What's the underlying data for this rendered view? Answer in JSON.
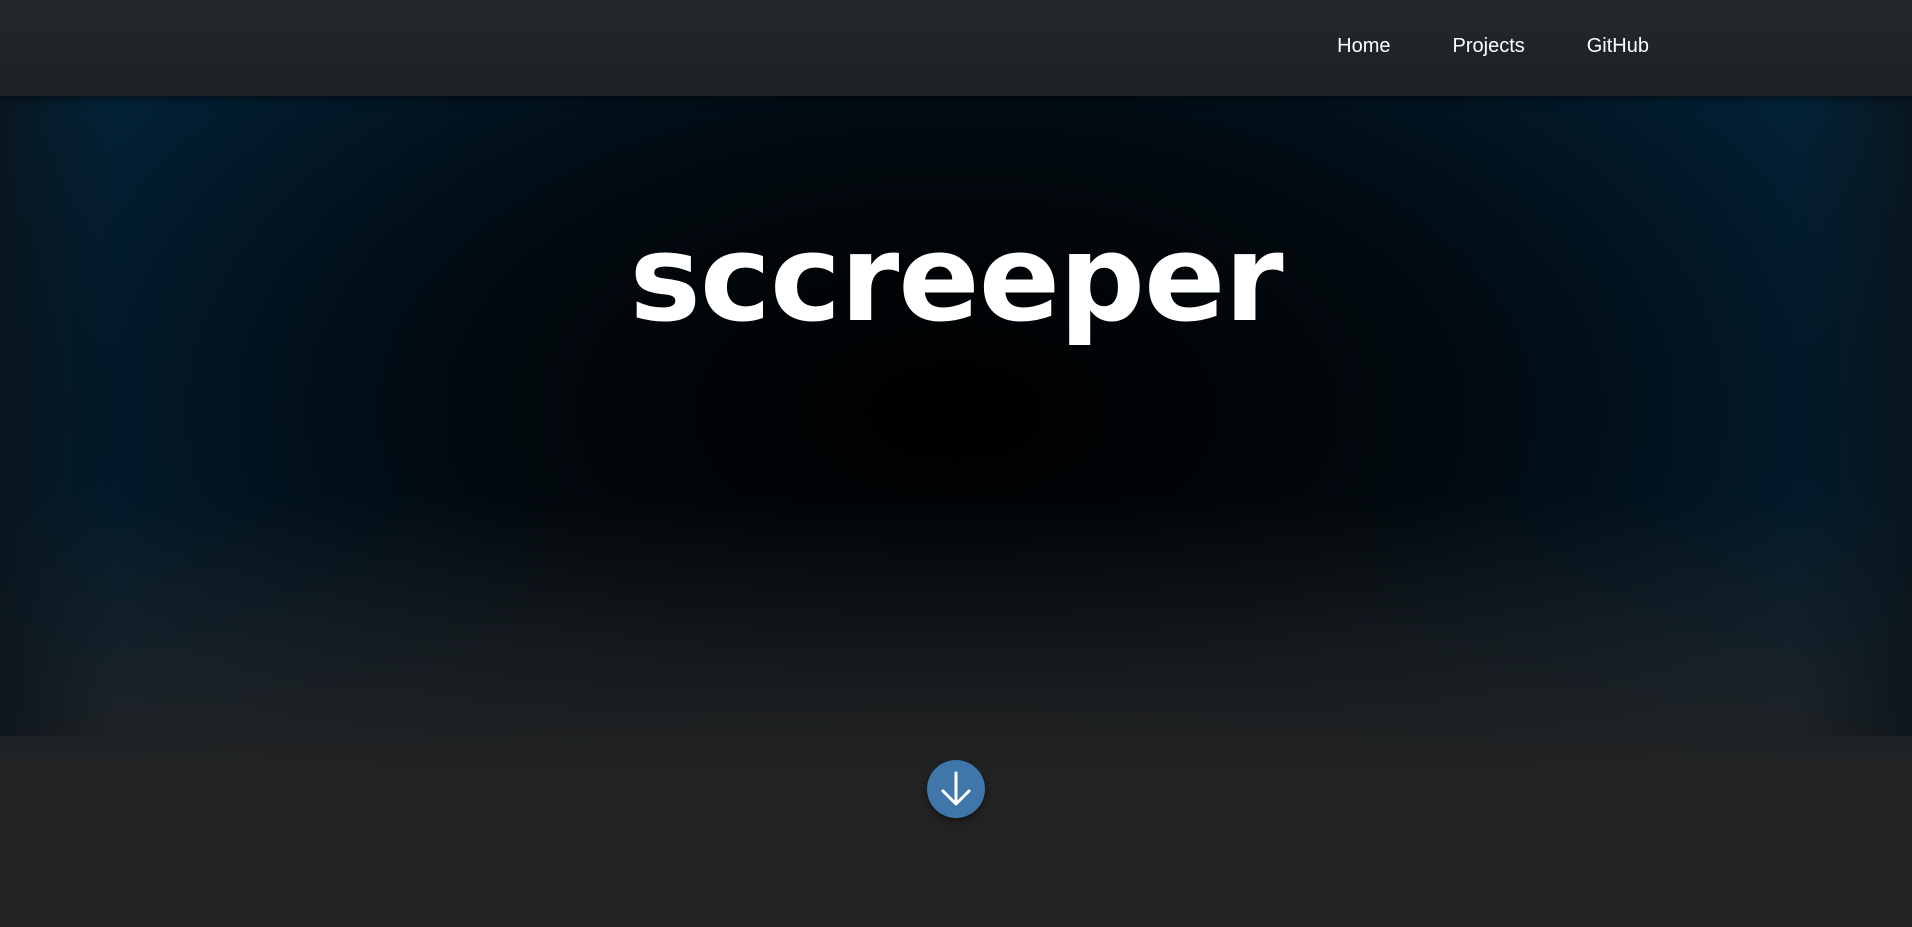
{
  "nav": {
    "items": [
      {
        "label": "Home"
      },
      {
        "label": "Projects"
      },
      {
        "label": "GitHub"
      }
    ]
  },
  "hero": {
    "title": "sccreeper",
    "scroll_icon": "arrow-down-icon"
  },
  "colors": {
    "navbar": "#25282b",
    "hero_center": "#000000",
    "hero_edge": "#03243a",
    "footer_bg": "#232323",
    "accent": "#3f77aa",
    "text": "#ffffff"
  }
}
